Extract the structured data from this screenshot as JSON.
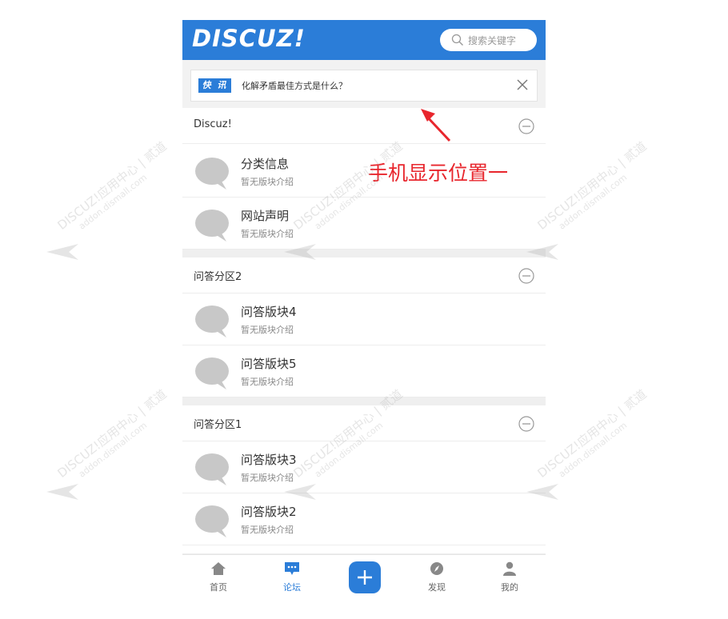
{
  "header": {
    "logo_text": "DISCUZ!",
    "search_placeholder": "搜索关键字"
  },
  "news": {
    "tag": "快 讯",
    "text": "化解矛盾最佳方式是什么？"
  },
  "categories": [
    {
      "title": "Discuz!",
      "forums": [
        {
          "name": "分类信息",
          "desc": "暂无版块介绍"
        },
        {
          "name": "网站声明",
          "desc": "暂无版块介绍"
        }
      ]
    },
    {
      "title": "问答分区2",
      "forums": [
        {
          "name": "问答版块4",
          "desc": "暂无版块介绍"
        },
        {
          "name": "问答版块5",
          "desc": "暂无版块介绍"
        }
      ]
    },
    {
      "title": "问答分区1",
      "forums": [
        {
          "name": "问答版块3",
          "desc": "暂无版块介绍"
        },
        {
          "name": "问答版块2",
          "desc": "暂无版块介绍"
        }
      ]
    }
  ],
  "tabbar": {
    "home": "首页",
    "forum": "论坛",
    "discover": "发现",
    "mine": "我的"
  },
  "annotation": "手机显示位置一",
  "watermark": {
    "main": "DISCUZ!应用中心 | 贰道",
    "sub": "addon.dismall.com"
  },
  "colors": {
    "brand": "#2b7dd8",
    "annotation": "#e8262d"
  }
}
